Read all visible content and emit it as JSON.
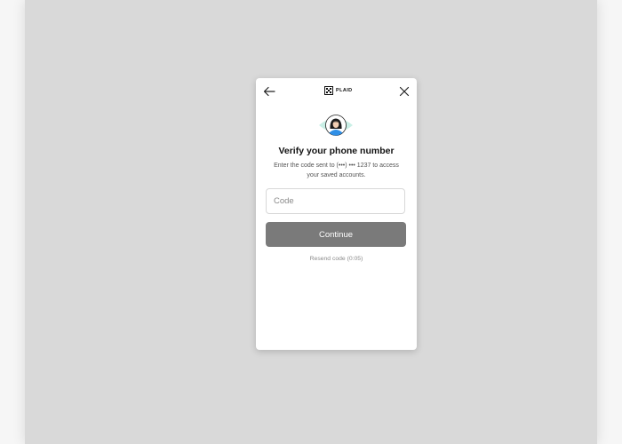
{
  "header": {
    "back_icon": "arrow-left-icon",
    "close_icon": "close-icon",
    "logo_text": "PLAID"
  },
  "illustration": {
    "icon": "user-avatar-icon",
    "accent_color": "#c9efe6"
  },
  "content": {
    "title": "Verify your phone number",
    "subtitle": "Enter the code sent to (•••) ••• 1237 to access your saved accounts."
  },
  "form": {
    "code_placeholder": "Code",
    "code_value": "",
    "continue_label": "Continue",
    "resend_label": "Resend code (0:05)"
  },
  "colors": {
    "backdrop": "#d9d9d9",
    "button": "#7a7a7a",
    "avatar_shirt": "#2f8fe6"
  }
}
